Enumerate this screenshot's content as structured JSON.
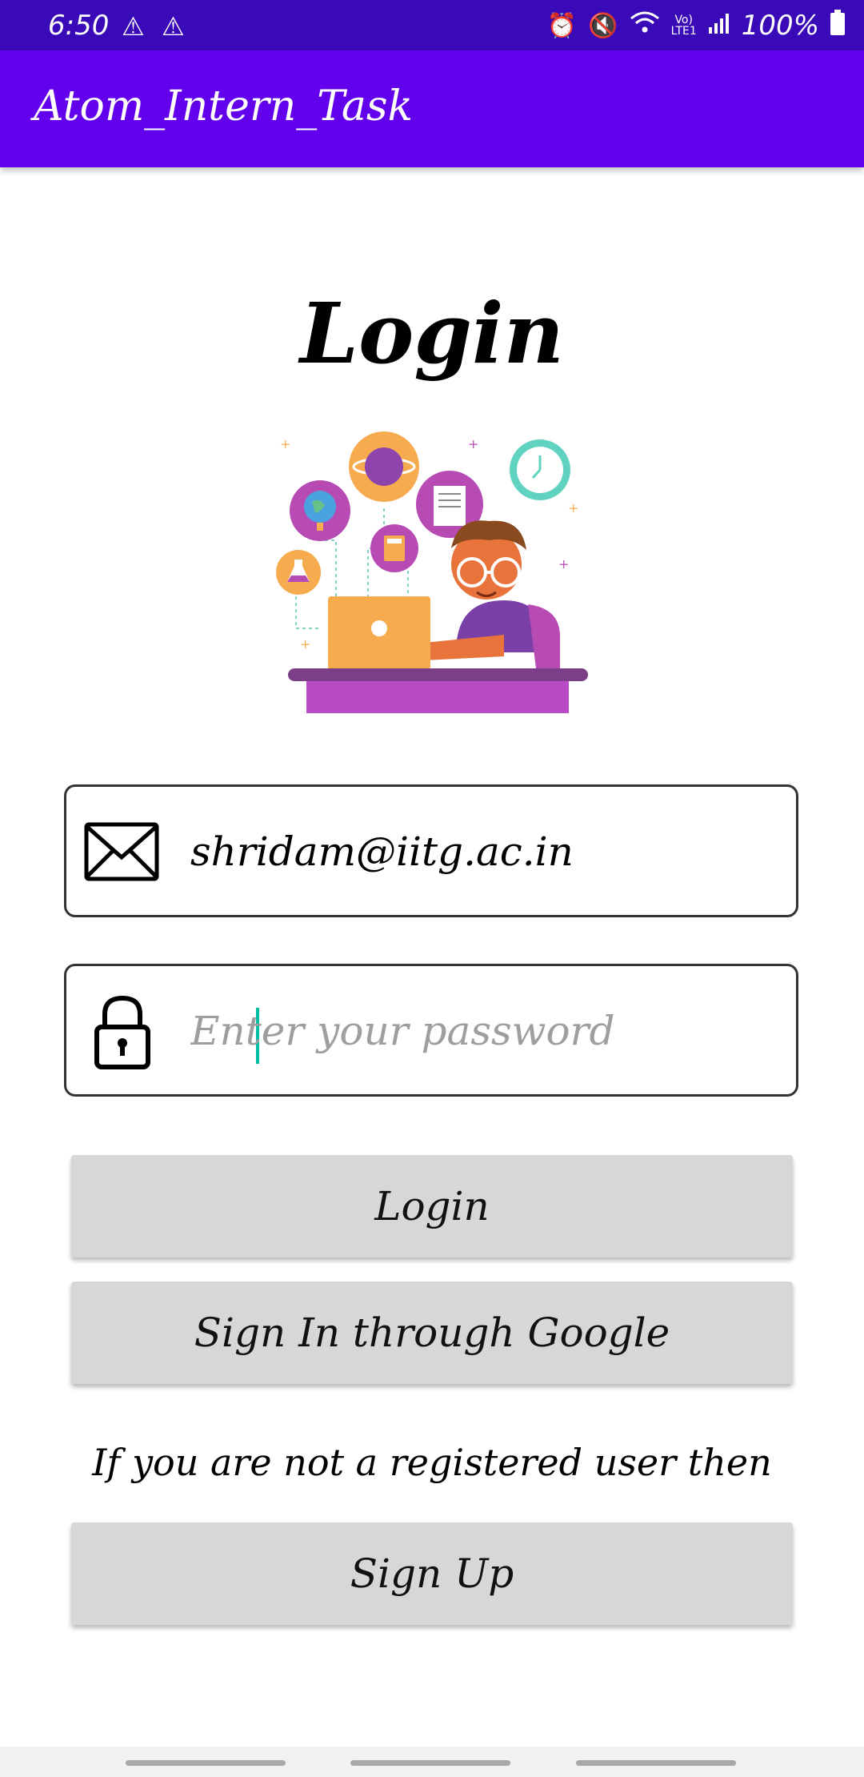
{
  "status_bar": {
    "time": "6:50",
    "battery_percent": "100%",
    "icons": [
      "warning-icon",
      "warning-icon",
      "alarm-icon",
      "mute-icon",
      "wifi-icon",
      "volte-icon",
      "signal-icon",
      "battery-icon"
    ]
  },
  "app_bar": {
    "title": "Atom_Intern_Task",
    "color": "#6200ee"
  },
  "page": {
    "title": "Login"
  },
  "illustration": {
    "icon": "student-laptop-illustration"
  },
  "form": {
    "email": {
      "icon": "mail-icon",
      "value": "shridam@iitg.ac.in",
      "placeholder": ""
    },
    "password": {
      "icon": "lock-icon",
      "value": "",
      "placeholder": "Enter your password"
    }
  },
  "buttons": {
    "login": "Login",
    "google": "Sign In through Google",
    "signup": "Sign Up"
  },
  "hint": "If you are not a registered user then",
  "colors": {
    "status_bar": "#3a0ab8",
    "button_bg": "#d6d7d7",
    "cursor": "#00bfa5"
  }
}
